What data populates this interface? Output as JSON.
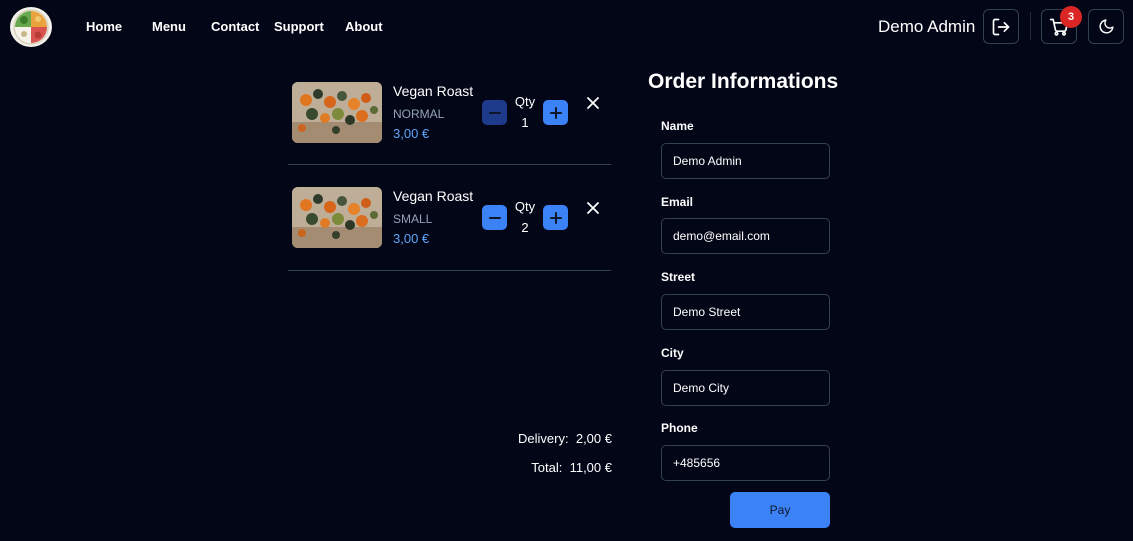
{
  "nav": {
    "links": [
      "Home",
      "Menu",
      "Contact",
      "Support",
      "About"
    ],
    "user_name": "Demo Admin",
    "cart_count": "3"
  },
  "cart": {
    "items": [
      {
        "name": "Vegan Roast",
        "size": "NORMAL",
        "price": "3,00 €",
        "qty_label": "Qty",
        "qty": "1"
      },
      {
        "name": "Vegan Roast",
        "size": "SMALL",
        "price": "3,00 €",
        "qty_label": "Qty",
        "qty": "2"
      }
    ],
    "delivery_label": "Delivery:",
    "delivery_value": "2,00 €",
    "total_label": "Total:",
    "total_value": "11,00 €"
  },
  "form": {
    "title": "Order Informations",
    "fields": [
      {
        "label": "Name",
        "value": "Demo Admin"
      },
      {
        "label": "Email",
        "value": "demo@email.com"
      },
      {
        "label": "Street",
        "value": "Demo Street"
      },
      {
        "label": "City",
        "value": "Demo City"
      },
      {
        "label": "Phone",
        "value": "+485656"
      }
    ],
    "pay_label": "Pay"
  },
  "colors": {
    "background": "#020617",
    "accent": "#3b82f6",
    "price": "#60a5fa",
    "badge": "#dc2626"
  }
}
